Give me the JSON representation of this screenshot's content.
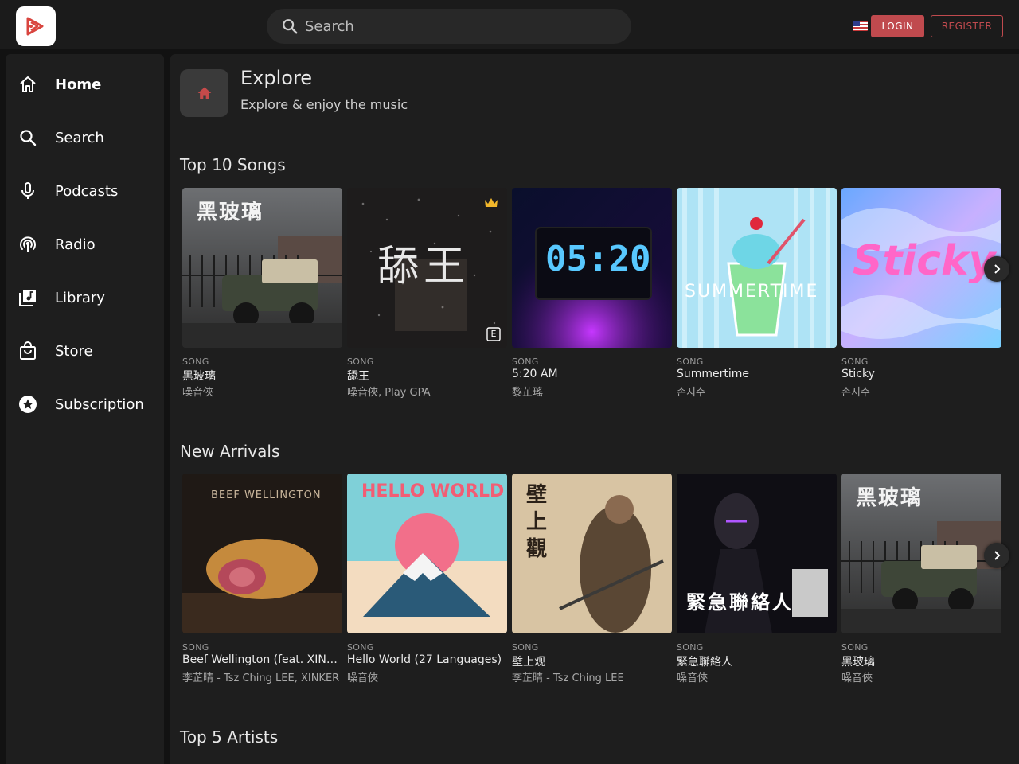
{
  "header": {
    "search_placeholder": "Search",
    "login_label": "LOGIN",
    "register_label": "REGISTER",
    "flag_icon": "us-flag-icon",
    "accent_color": "#c04a4e"
  },
  "sidebar": {
    "items": [
      {
        "label": "Home",
        "icon": "home-icon"
      },
      {
        "label": "Search",
        "icon": "search-icon"
      },
      {
        "label": "Podcasts",
        "icon": "microphone-icon"
      },
      {
        "label": "Radio",
        "icon": "radio-icon"
      },
      {
        "label": "Library",
        "icon": "library-icon"
      },
      {
        "label": "Store",
        "icon": "shopping-bag-icon"
      },
      {
        "label": "Subscription",
        "icon": "star-icon"
      }
    ]
  },
  "explore": {
    "title": "Explore",
    "subtitle": "Explore & enjoy the music"
  },
  "sections": {
    "top_songs": {
      "title": "Top 10 Songs",
      "cards": [
        {
          "type": "SONG",
          "title": "黑玻璃",
          "artist": "噪音俠",
          "cover_text": "黑玻璃"
        },
        {
          "type": "SONG",
          "title": "舔王",
          "artist": "噪音俠, Play GPA",
          "cover_text": "舔王",
          "badge": "crown-icon",
          "explicit": "E"
        },
        {
          "type": "SONG",
          "title": "5:20 AM",
          "artist": "黎芷瑤",
          "cover_text": "05:20"
        },
        {
          "type": "SONG",
          "title": "Summertime",
          "artist": "손지수",
          "cover_text": "SUMMERTIME"
        },
        {
          "type": "SONG",
          "title": "Sticky",
          "artist": "손지수",
          "cover_text": "Sticky"
        }
      ]
    },
    "new_arrivals": {
      "title": "New Arrivals",
      "cards": [
        {
          "type": "SONG",
          "title": "Beef Wellington (feat. XINKER)",
          "artist": "李芷晴 - Tsz Ching LEE, XINKER",
          "cover_text": "BEEF WELLINGTON"
        },
        {
          "type": "SONG",
          "title": "Hello World (27 Languages)",
          "artist": "噪音俠",
          "cover_text": "HELLO WORLD"
        },
        {
          "type": "SONG",
          "title": "壁上观",
          "artist": "李芷晴 - Tsz Ching LEE",
          "cover_text": "壁上觀"
        },
        {
          "type": "SONG",
          "title": "緊急聯絡人",
          "artist": "噪音俠",
          "cover_text": "緊急聯絡人"
        },
        {
          "type": "SONG",
          "title": "黑玻璃",
          "artist": "噪音俠",
          "cover_text": "黑玻璃"
        }
      ]
    },
    "top_artists": {
      "title": "Top 5 Artists"
    }
  }
}
